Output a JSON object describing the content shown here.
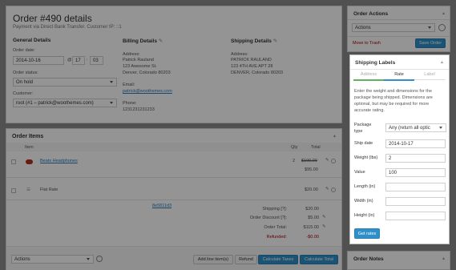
{
  "order": {
    "title": "Order #490 details",
    "subtitle": "Payment via Direct Bank Transfer. Customer IP: ::1",
    "general_heading": "General Details",
    "order_date_label": "Order date:",
    "order_date": "2014-10-16",
    "at": "@",
    "hour": "17",
    "colon": ":",
    "minute": "03",
    "status_label": "Order status:",
    "status": "On hold",
    "customer_label": "Customer:",
    "customer": "root (#1 – patrick@woothemes.com)",
    "billing_heading": "Billing Details",
    "billing_address_label": "Address:",
    "billing_address": [
      "Patrick Rauland",
      "123 Awesome St.",
      "Denver, Colorado 80203"
    ],
    "email_label": "Email:",
    "email": "patrick@woothemes.com",
    "phone_label": "Phone:",
    "phone": "1231231231233",
    "shipping_heading": "Shipping Details",
    "shipping_address_label": "Address:",
    "shipping_address": [
      "PATRICK RAULAND",
      "123 4TH AVE APT 28",
      "DENVER, Colorado 80203"
    ]
  },
  "order_items": {
    "heading": "Order Items",
    "col_item": "Item",
    "col_qty": "Qty",
    "col_total": "Total",
    "product_name": "Beats Headphones",
    "product_qty": "2",
    "product_old_price": "$100.00",
    "product_price": "$95.00",
    "shipping_name": "Flat Rate",
    "shipping_price": "$20.00",
    "coupon": "8e5811d3",
    "summary": [
      {
        "label": "Shipping [?]:",
        "value": "$20.00"
      },
      {
        "label": "Order Discount [?]:",
        "value": "$5.00"
      },
      {
        "label": "Order Total:",
        "value": "$115.00"
      },
      {
        "label": "Refunded:",
        "value": "-$0.00"
      }
    ],
    "bulk_action": "Actions",
    "add_line_items": "Add line item(s)",
    "refund": "Refund",
    "calc_taxes": "Calculate Taxes",
    "calc_total": "Calculate Total"
  },
  "order_actions": {
    "heading": "Order Actions",
    "select": "Actions",
    "trash": "Move to Trash",
    "save": "Save Order"
  },
  "shipping_labels": {
    "heading": "Shipping Labels",
    "tabs": [
      "Address",
      "Rate",
      "Label"
    ],
    "description": [
      "Enter the weight and dimensions for the",
      "package being shipped. Dimensions are",
      "optional, but may be required for more",
      "accurate rating."
    ],
    "package_type_label": [
      "Package",
      "type"
    ],
    "package_type": "Any (return all optic",
    "ship_date_label": "Ship date",
    "ship_date": "2014-10-17",
    "weight_label": "Weight (lbs)",
    "weight": "2",
    "value_label": "Value",
    "value": "100",
    "length_label": "Length (in)",
    "width_label": "Width (in)",
    "height_label": "Height (in)",
    "get_rates": "Get rates"
  },
  "order_notes": {
    "heading": "Order Notes"
  }
}
